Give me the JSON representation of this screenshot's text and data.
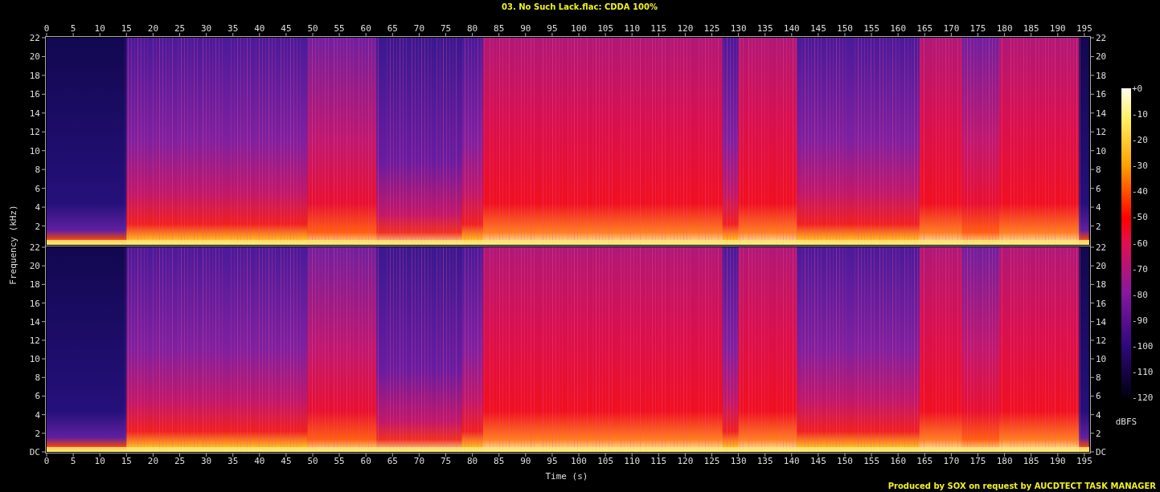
{
  "title": "03. No Such Lack.flac: CDDA 100%",
  "time_axis": {
    "label": "Time (s)",
    "top_ticks": [
      "0",
      "5",
      "10",
      "15",
      "20",
      "25",
      "30",
      "35",
      "40",
      "45",
      "50",
      "55",
      "60",
      "65",
      "70",
      "75",
      "80",
      "85",
      "90",
      "95",
      "100",
      "105",
      "110",
      "115",
      "120",
      "125",
      "130",
      "135",
      "140",
      "145",
      "150",
      "155",
      "160",
      "165",
      "170",
      "175",
      "180",
      "185",
      "190",
      "195"
    ],
    "bottom_ticks": [
      "0",
      "5",
      "10",
      "15",
      "20",
      "25",
      "30",
      "35",
      "40",
      "45",
      "50",
      "55",
      "60",
      "65",
      "70",
      "75",
      "80",
      "85",
      "90",
      "95",
      "100",
      "105",
      "110",
      "115",
      "120",
      "125",
      "130",
      "135",
      "140",
      "145",
      "150",
      "155",
      "160",
      "165",
      "170",
      "175",
      "180",
      "185",
      "190",
      "195"
    ]
  },
  "frequency_axis": {
    "label": "Frequency (kHz)",
    "channels": [
      {
        "left_ticks": [
          "22",
          "20",
          "18",
          "16",
          "14",
          "12",
          "10",
          "8",
          "6",
          "4",
          "2"
        ],
        "right_ticks": [
          "22",
          "20",
          "18",
          "16",
          "14",
          "12",
          "10",
          "8",
          "6",
          "4",
          "2"
        ]
      },
      {
        "left_ticks": [
          "22",
          "20",
          "18",
          "16",
          "14",
          "12",
          "10",
          "8",
          "6",
          "4",
          "2",
          "DC"
        ],
        "right_ticks": [
          "22",
          "20",
          "18",
          "16",
          "14",
          "12",
          "10",
          "8",
          "6",
          "4",
          "2",
          "DC"
        ]
      }
    ]
  },
  "color_scale": {
    "unit": "dBFS",
    "ticks": [
      "+0",
      "-10",
      "-20",
      "-30",
      "-40",
      "-50",
      "-60",
      "-70",
      "-80",
      "-90",
      "-100",
      "-110",
      "-120"
    ]
  },
  "footer": "Produced by SOX on request by AUCDTECT TASK MANAGER"
}
